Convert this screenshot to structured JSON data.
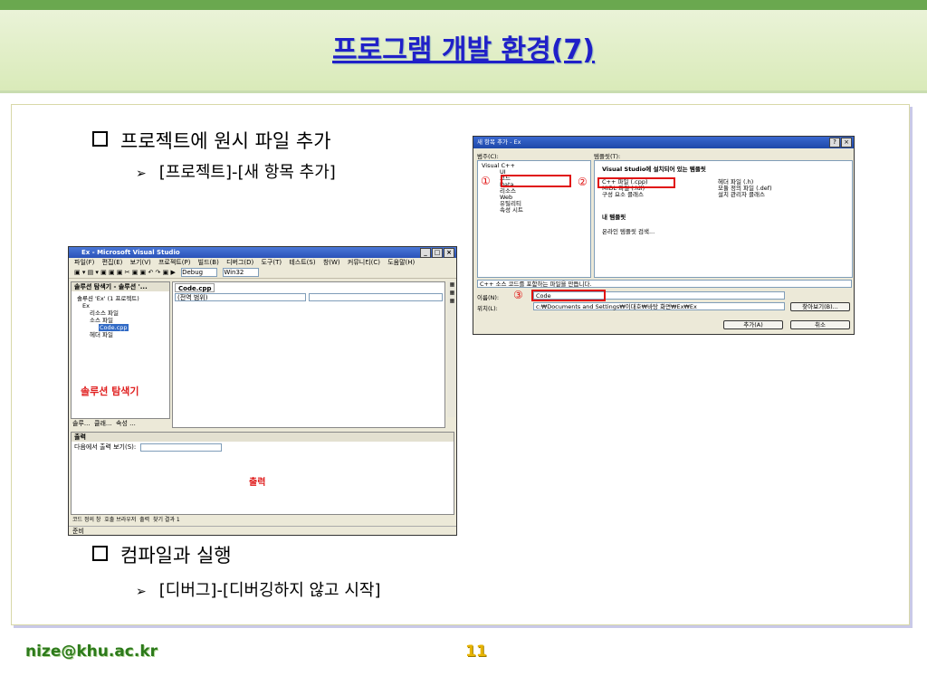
{
  "header": {
    "title": "프로그램 개발 환경(7)"
  },
  "bullets": [
    {
      "text": "프로젝트에 원시 파일 추가",
      "sub": "[프로젝트]-[새 항목 추가]"
    },
    {
      "text": "컴파일과 실행",
      "sub": "[디버그]-[디버깅하지 않고 시작]"
    }
  ],
  "footer": {
    "email": "nize@khu.ac.kr",
    "page": "11"
  },
  "vs": {
    "title": "Ex - Microsoft Visual Studio",
    "menu": [
      "파일(F)",
      "편집(E)",
      "보기(V)",
      "프로젝트(P)",
      "빌드(B)",
      "디버그(D)",
      "도구(T)",
      "테스트(S)",
      "창(W)",
      "커뮤니티(C)",
      "도움말(H)"
    ],
    "config": "Debug",
    "platform": "Win32",
    "solution_header": "솔루션 탐색기 - 솔루션 '...",
    "tab_file": "Code.cpp",
    "scope": "(전역 범위)",
    "tree": [
      "솔루션 'Ex' (1 프로젝트)",
      "Ex",
      "리소스 파일",
      "소스 파일",
      "Code.cpp",
      "헤더 파일"
    ],
    "solution_label": "솔루션 탐색기",
    "bottom_tabs": [
      "솔루...",
      "클래...",
      "속성 ..."
    ],
    "output_header": "출력",
    "output_show": "다음에서 출력 보기(S):",
    "output_label": "출력",
    "output_tabs": [
      "코드 정의 창",
      "호출 브라우저",
      "출력",
      "찾기 결과 1"
    ],
    "status": "준비"
  },
  "dialog": {
    "title": "새 항목 추가 - Ex",
    "category_label": "범주(C):",
    "template_label": "템플릿(T):",
    "categories": [
      "Visual C++",
      "UI",
      "코드",
      "Data",
      "리소스",
      "Web",
      "유틸리티",
      "속성 시트"
    ],
    "installed_header": "Visual Studio에 설치되어 있는 템플릿",
    "templates_left": [
      "C++ 파일 (.cpp)",
      "MIDL 파일 (.idl)",
      "구성 요소 클래스"
    ],
    "templates_right": [
      "헤더 파일 (.h)",
      "모듈 정의 파일 (.def)",
      "설치 관리자 클래스"
    ],
    "my_templates": "내 템플릿",
    "online": "온라인 템플릿 검색...",
    "description": "C++ 소스 코드를 포함하는 파일을 만듭니다.",
    "name_label": "이름(N):",
    "name_value": "Code",
    "location_label": "위치(L):",
    "location_value": "c:₩Documents and Settings₩이대호₩바탕 화면₩Ex₩Ex",
    "browse": "찾아보기(B)...",
    "add": "추가(A)",
    "cancel": "취소",
    "marks": [
      "①",
      "②",
      "③"
    ]
  }
}
